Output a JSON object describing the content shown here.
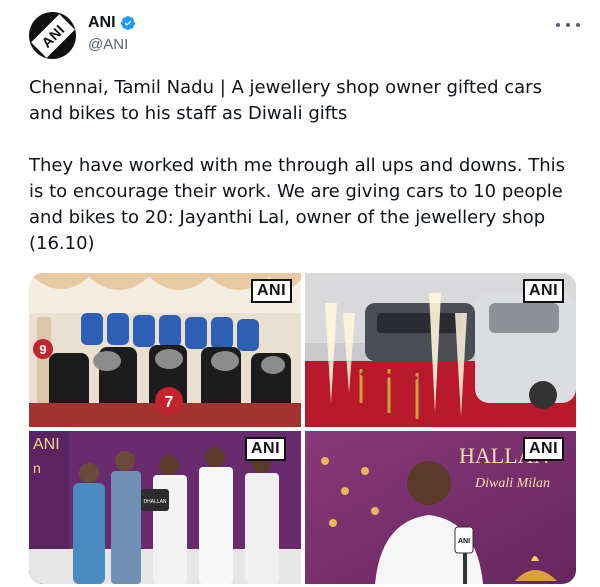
{
  "account": {
    "name": "ANI",
    "handle": "@ANI",
    "avatar_text": "ANI"
  },
  "tweet": {
    "text": "Chennai, Tamil Nadu | A jewellery shop owner gifted cars and bikes to his staff as Diwali gifts\n\nThey have worked with me through all ups and downs. This is to encourage their work. We are giving cars to 10 people and bikes to 20: Jayanthi Lal, owner of the jewellery shop (16.10)"
  },
  "media": {
    "watermark": "ANI",
    "photo1": {
      "tag_9": "9",
      "tag_7": "7"
    },
    "photo3": {
      "banner_left": "ANI",
      "banner_sub": "n",
      "cert_text": "DHALLAN"
    },
    "photo4": {
      "banner_title": "HALLAN",
      "banner_sub": "Diwali Milan",
      "mic_label": "ANI"
    }
  },
  "colors": {
    "accent": "#1d9bf0",
    "text": "#0f1419",
    "muted": "#536471",
    "banner_purple": "#6a2b6e",
    "carpet_red": "#b8192b"
  },
  "icons": [
    "verified-badge-icon",
    "more-options-icon"
  ]
}
